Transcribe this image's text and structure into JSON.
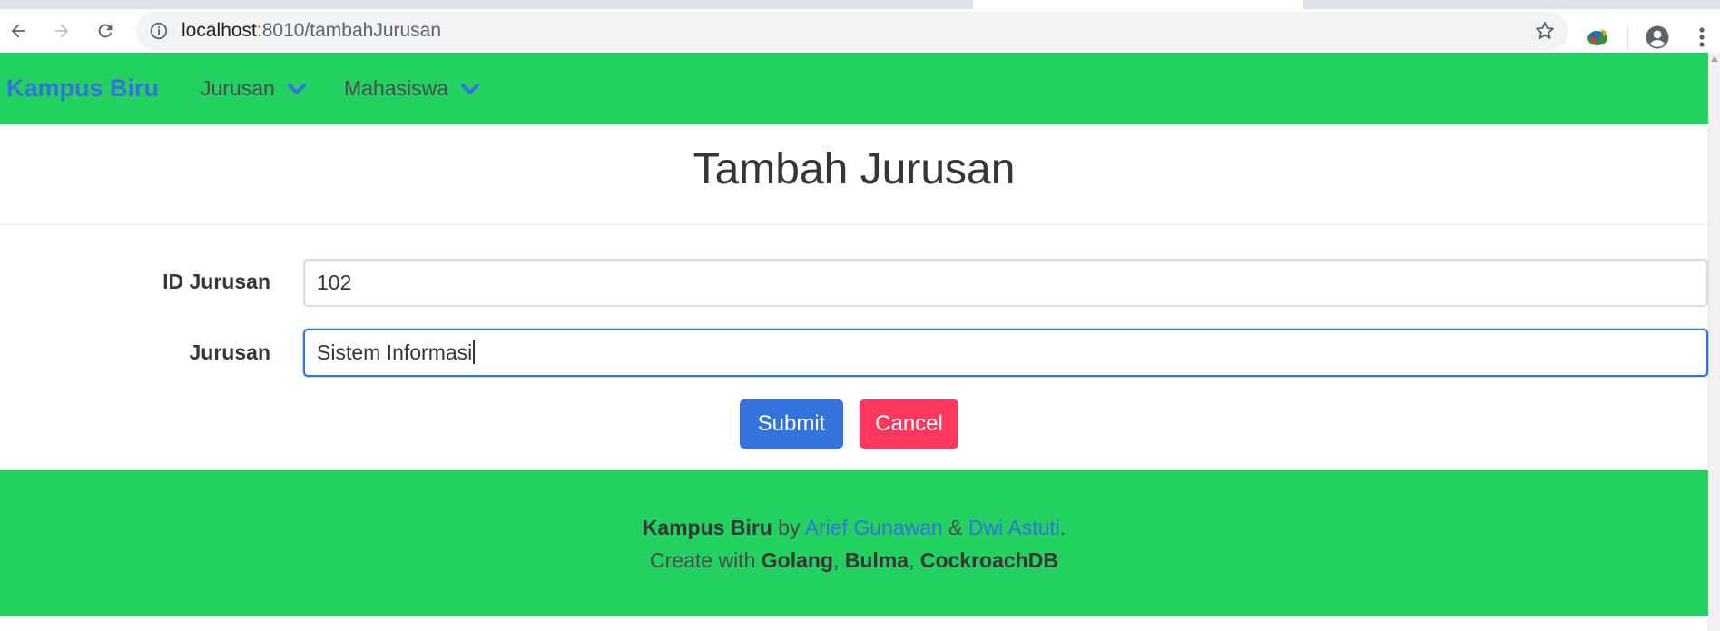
{
  "browser": {
    "url_host": "localhost",
    "url_rest": ":8010/tambahJurusan"
  },
  "navbar": {
    "brand": "Kampus Biru",
    "items": [
      {
        "label": "Jurusan"
      },
      {
        "label": "Mahasiswa"
      }
    ]
  },
  "page": {
    "title": "Tambah Jurusan"
  },
  "form": {
    "id_label": "ID Jurusan",
    "id_value": "102",
    "jurusan_label": "Jurusan",
    "jurusan_value": "Sistem Informasi",
    "submit_label": "Submit",
    "cancel_label": "Cancel"
  },
  "footer": {
    "brand": "Kampus Biru",
    "by": " by ",
    "author1": "Arief Gunawan",
    "amp": " & ",
    "author2": "Dwi Astuti",
    "period": ".",
    "create_with": "Create with ",
    "tech1": "Golang",
    "comma1": ", ",
    "tech2": "Bulma",
    "comma2": ", ",
    "tech3": "CockroachDB"
  },
  "colors": {
    "accent_green": "#23d160",
    "link_blue": "#3273dc",
    "danger": "#ff3860"
  },
  "icons": [
    "back-arrow-icon",
    "forward-arrow-icon",
    "reload-icon",
    "info-icon",
    "star-icon",
    "extension-icon",
    "profile-icon",
    "menu-dots-icon",
    "chevron-down-icon"
  ]
}
